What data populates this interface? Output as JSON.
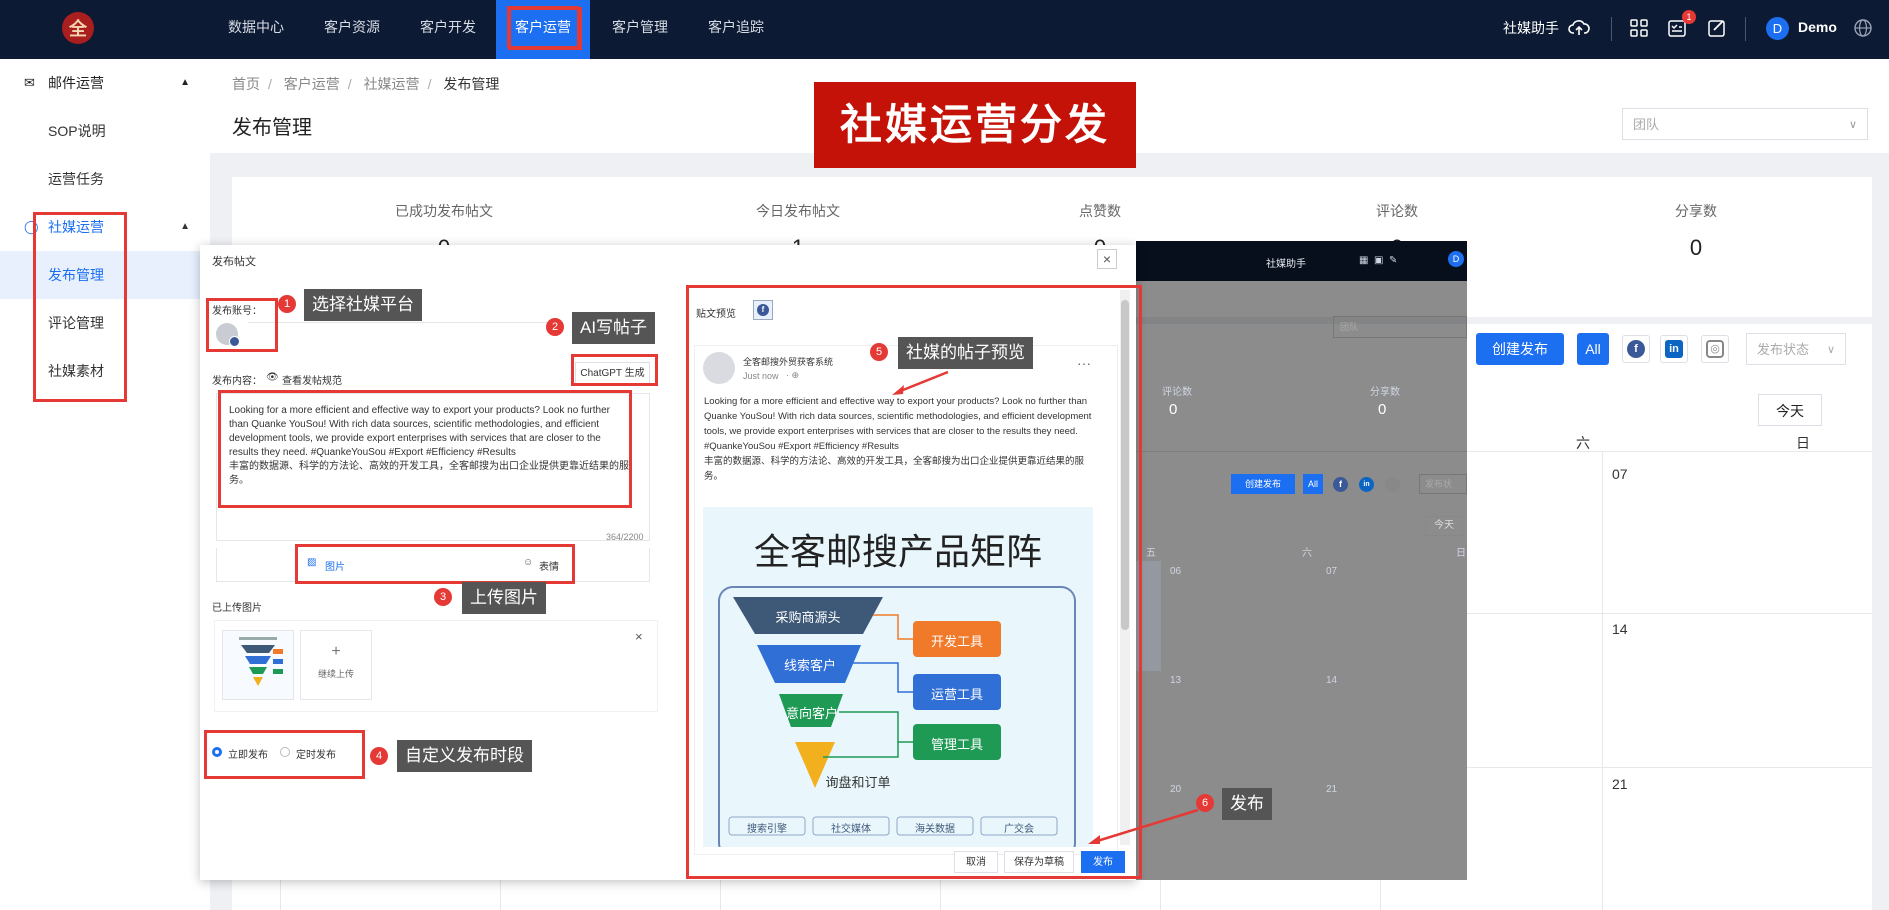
{
  "nav": {
    "logo_text": "全",
    "items": [
      "数据中心",
      "客户资源",
      "客户开发",
      "客户运营",
      "客户管理",
      "客户追踪"
    ],
    "active": "客户运营",
    "assistant": "社媒助手",
    "notification_count": "1",
    "user_initial": "D",
    "user_name": "Demo"
  },
  "sidebar": {
    "groups": [
      {
        "label": "邮件运营",
        "items": [
          "SOP说明",
          "运营任务"
        ]
      },
      {
        "label": "社媒运营",
        "items": [
          "发布管理",
          "评论管理",
          "社媒素材"
        ]
      }
    ],
    "selected": "发布管理"
  },
  "breadcrumb": [
    "首页",
    "客户运营",
    "社媒运营",
    "发布管理"
  ],
  "page_title": "发布管理",
  "team_placeholder": "团队",
  "banner": "社媒运营分发",
  "stats": [
    {
      "title": "已成功发布帖文",
      "value": "0"
    },
    {
      "title": "今日发布帖文",
      "value": "1"
    },
    {
      "title": "点赞数",
      "value": "0"
    },
    {
      "title": "评论数",
      "value": "0"
    },
    {
      "title": "分享数",
      "value": "0"
    }
  ],
  "toolbar": {
    "create": "创建发布",
    "all": "All",
    "status_placeholder": "发布状态",
    "today": "今天"
  },
  "calendar": {
    "weekdays_visible": [
      "六",
      "日"
    ],
    "days_right": [
      "07",
      "14",
      "21"
    ],
    "overlay_weekdays": [
      "五",
      "六",
      "日"
    ],
    "overlay_days": [
      "06",
      "07",
      "13",
      "14",
      "20",
      "21"
    ]
  },
  "overlay_preview": {
    "assistant": "社媒助手",
    "team": "团队",
    "stat_titles": [
      "评论数",
      "分享数"
    ],
    "stat_values": [
      "0",
      "0"
    ],
    "create": "创建发布",
    "all": "All",
    "status": "发布状",
    "today": "今天"
  },
  "modal": {
    "title": "发布帖文",
    "close": "×",
    "account_label": "发布账号：",
    "content_label": "发布内容：",
    "guide_link": "查看发帖规范",
    "gpt_button": "ChatGPT 生成",
    "content_text": "Looking for a more efficient and effective way to export your products? Look no further than Quanke YouSou! With rich data sources, scientific methodologies, and efficient development tools, we provide export enterprises with services that are closer to the results they need. #QuankeYouSou #Export #Efficiency #Results\n丰富的数据源、科学的方法论、高效的开发工具，全客邮搜为出口企业提供更靠近结果的服务。",
    "char_count": "364/2200",
    "image_tool": "图片",
    "emoji_tool": "表情",
    "uploaded_label": "已上传图片",
    "continue_upload": "继续上传",
    "publish_now": "立即发布",
    "schedule": "定时发布",
    "preview_label": "贴文预览",
    "preview_account": "全客邮搜外贸获客系统",
    "preview_time": "Just now",
    "poster": {
      "title": "全客邮搜产品矩阵",
      "funnel": [
        "采购商源头",
        "线索客户",
        "意向客户",
        "询盘和订单"
      ],
      "tools": [
        "开发工具",
        "运营工具",
        "管理工具"
      ],
      "chips": [
        "搜索引擎",
        "社交媒体",
        "海关数据",
        "广交会"
      ]
    },
    "cancel": "取消",
    "save_draft": "保存为草稿",
    "publish": "发布"
  },
  "annotations": [
    {
      "num": "1",
      "text": "选择社媒平台"
    },
    {
      "num": "2",
      "text": "AI写帖子"
    },
    {
      "num": "3",
      "text": "上传图片"
    },
    {
      "num": "4",
      "text": "自定义发布时段"
    },
    {
      "num": "5",
      "text": "社媒的帖子预览"
    },
    {
      "num": "6",
      "text": "发布"
    }
  ],
  "colors": {
    "nav_bg": "#0d1a33",
    "accent": "#1d6ff2",
    "annotation_red": "#e53935",
    "banner_red": "#c41208",
    "facebook": "#3b5998",
    "linkedin": "#0a66c2"
  }
}
